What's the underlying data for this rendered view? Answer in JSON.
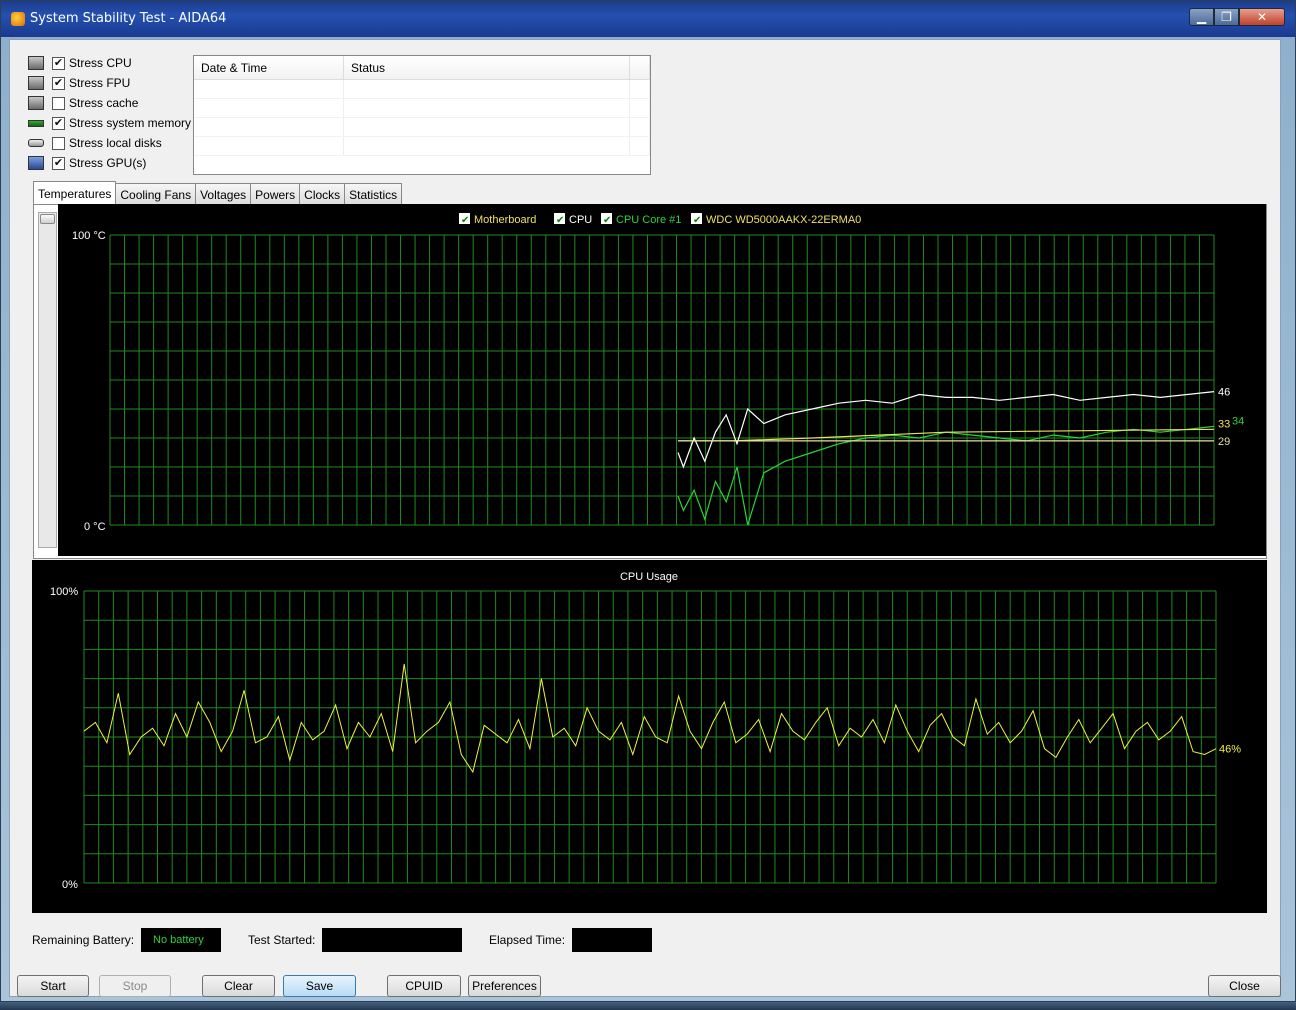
{
  "window": {
    "title": "System Stability Test - AIDA64",
    "buttons": {
      "minimize": "▁",
      "maximize": "❐",
      "close": "✕"
    }
  },
  "stress_options": [
    {
      "label": "Stress CPU",
      "checked": true,
      "icon": "cpu-chip-icon"
    },
    {
      "label": "Stress FPU",
      "checked": true,
      "icon": "fpu-chip-icon"
    },
    {
      "label": "Stress cache",
      "checked": false,
      "icon": "cache-chip-icon"
    },
    {
      "label": "Stress system memory",
      "checked": true,
      "icon": "memory-module-icon"
    },
    {
      "label": "Stress local disks",
      "checked": false,
      "icon": "hard-disk-icon"
    },
    {
      "label": "Stress GPU(s)",
      "checked": true,
      "icon": "gpu-monitor-icon"
    }
  ],
  "status_table": {
    "columns": [
      "Date & Time",
      "Status"
    ],
    "rows": []
  },
  "tabs": [
    "Temperatures",
    "Cooling Fans",
    "Voltages",
    "Powers",
    "Clocks",
    "Statistics"
  ],
  "active_tab": "Temperatures",
  "temperature_chart": {
    "legend": [
      {
        "name": "Motherboard",
        "color": "#f0e060",
        "checked": true
      },
      {
        "name": "CPU",
        "color": "#ffffff",
        "checked": true
      },
      {
        "name": "CPU Core #1",
        "color": "#2cd33a",
        "checked": true
      },
      {
        "name": "WDC WD5000AAKX-22ERMA0",
        "color": "#f0e060",
        "checked": true
      }
    ],
    "y_top_label": "100 °C",
    "y_bottom_label": "0 °C"
  },
  "cpu_chart": {
    "title": "CPU Usage",
    "y_top_label": "100%",
    "y_bottom_label": "0%"
  },
  "chart_data": [
    {
      "type": "line",
      "title": "",
      "xlabel": "",
      "ylabel": "",
      "ylim": [
        0,
        100
      ],
      "grid": true,
      "legend_placement": "top-center",
      "series": [
        {
          "name": "CPU",
          "color": "#ffffff",
          "end_label": "46",
          "x": [
            0,
            1,
            3,
            5,
            7,
            9,
            11,
            13,
            16,
            20,
            25,
            30,
            35,
            40,
            45,
            50,
            55,
            60,
            65,
            70,
            75,
            80,
            85,
            90,
            95,
            100
          ],
          "values": [
            25,
            20,
            30,
            22,
            32,
            38,
            28,
            40,
            35,
            38,
            40,
            42,
            43,
            42,
            45,
            44,
            44,
            43,
            44,
            45,
            43,
            44,
            45,
            44,
            45,
            46
          ]
        },
        {
          "name": "CPU Core #1",
          "color": "#2cd33a",
          "end_label": "34",
          "x": [
            0,
            1,
            3,
            5,
            7,
            9,
            11,
            13,
            16,
            20,
            25,
            30,
            35,
            40,
            45,
            50,
            55,
            60,
            65,
            70,
            75,
            80,
            85,
            90,
            95,
            100
          ],
          "values": [
            10,
            5,
            12,
            2,
            15,
            8,
            20,
            0,
            18,
            22,
            25,
            28,
            30,
            31,
            30,
            32,
            31,
            30,
            29,
            31,
            30,
            32,
            33,
            32,
            33,
            34
          ]
        },
        {
          "name": "Motherboard",
          "color": "#f0e060",
          "end_label": "33",
          "x": [
            0,
            6,
            10,
            25,
            50,
            100
          ],
          "values": [
            29,
            29,
            29,
            30,
            32,
            33
          ]
        },
        {
          "name": "WDC WD5000AAKX-22ERMA0",
          "color": "#e8e0a0",
          "end_label": "29",
          "x": [
            0,
            10,
            25,
            50,
            100
          ],
          "values": [
            29,
            29,
            29,
            29,
            29
          ]
        }
      ]
    },
    {
      "type": "line",
      "title": "CPU Usage",
      "ylim": [
        0,
        100
      ],
      "grid": true,
      "series": [
        {
          "name": "",
          "color": "#f0f040",
          "end_label": "46%",
          "values": [
            52,
            55,
            48,
            65,
            44,
            50,
            53,
            47,
            58,
            50,
            62,
            55,
            45,
            52,
            66,
            48,
            50,
            57,
            42,
            55,
            49,
            52,
            61,
            46,
            55,
            50,
            58,
            45,
            75,
            48,
            52,
            55,
            62,
            44,
            38,
            54,
            51,
            48,
            56,
            46,
            70,
            50,
            53,
            47,
            60,
            52,
            49,
            55,
            44,
            57,
            50,
            48,
            64,
            52,
            46,
            55,
            62,
            48,
            51,
            56,
            45,
            58,
            52,
            49,
            55,
            60,
            47,
            53,
            50,
            56,
            48,
            61,
            52,
            45,
            54,
            58,
            50,
            47,
            63,
            51,
            55,
            48,
            52,
            59,
            46,
            43,
            50,
            56,
            48,
            53,
            58,
            46,
            52,
            55,
            49,
            52,
            57,
            45,
            44,
            46
          ]
        }
      ]
    }
  ],
  "bottom_info": {
    "battery_label": "Remaining Battery:",
    "battery_value": "No battery",
    "started_label": "Test Started:",
    "started_value": "",
    "elapsed_label": "Elapsed Time:",
    "elapsed_value": ""
  },
  "buttons": {
    "start": "Start",
    "stop": "Stop",
    "clear": "Clear",
    "save": "Save",
    "cpuid": "CPUID",
    "preferences": "Preferences",
    "close": "Close"
  }
}
